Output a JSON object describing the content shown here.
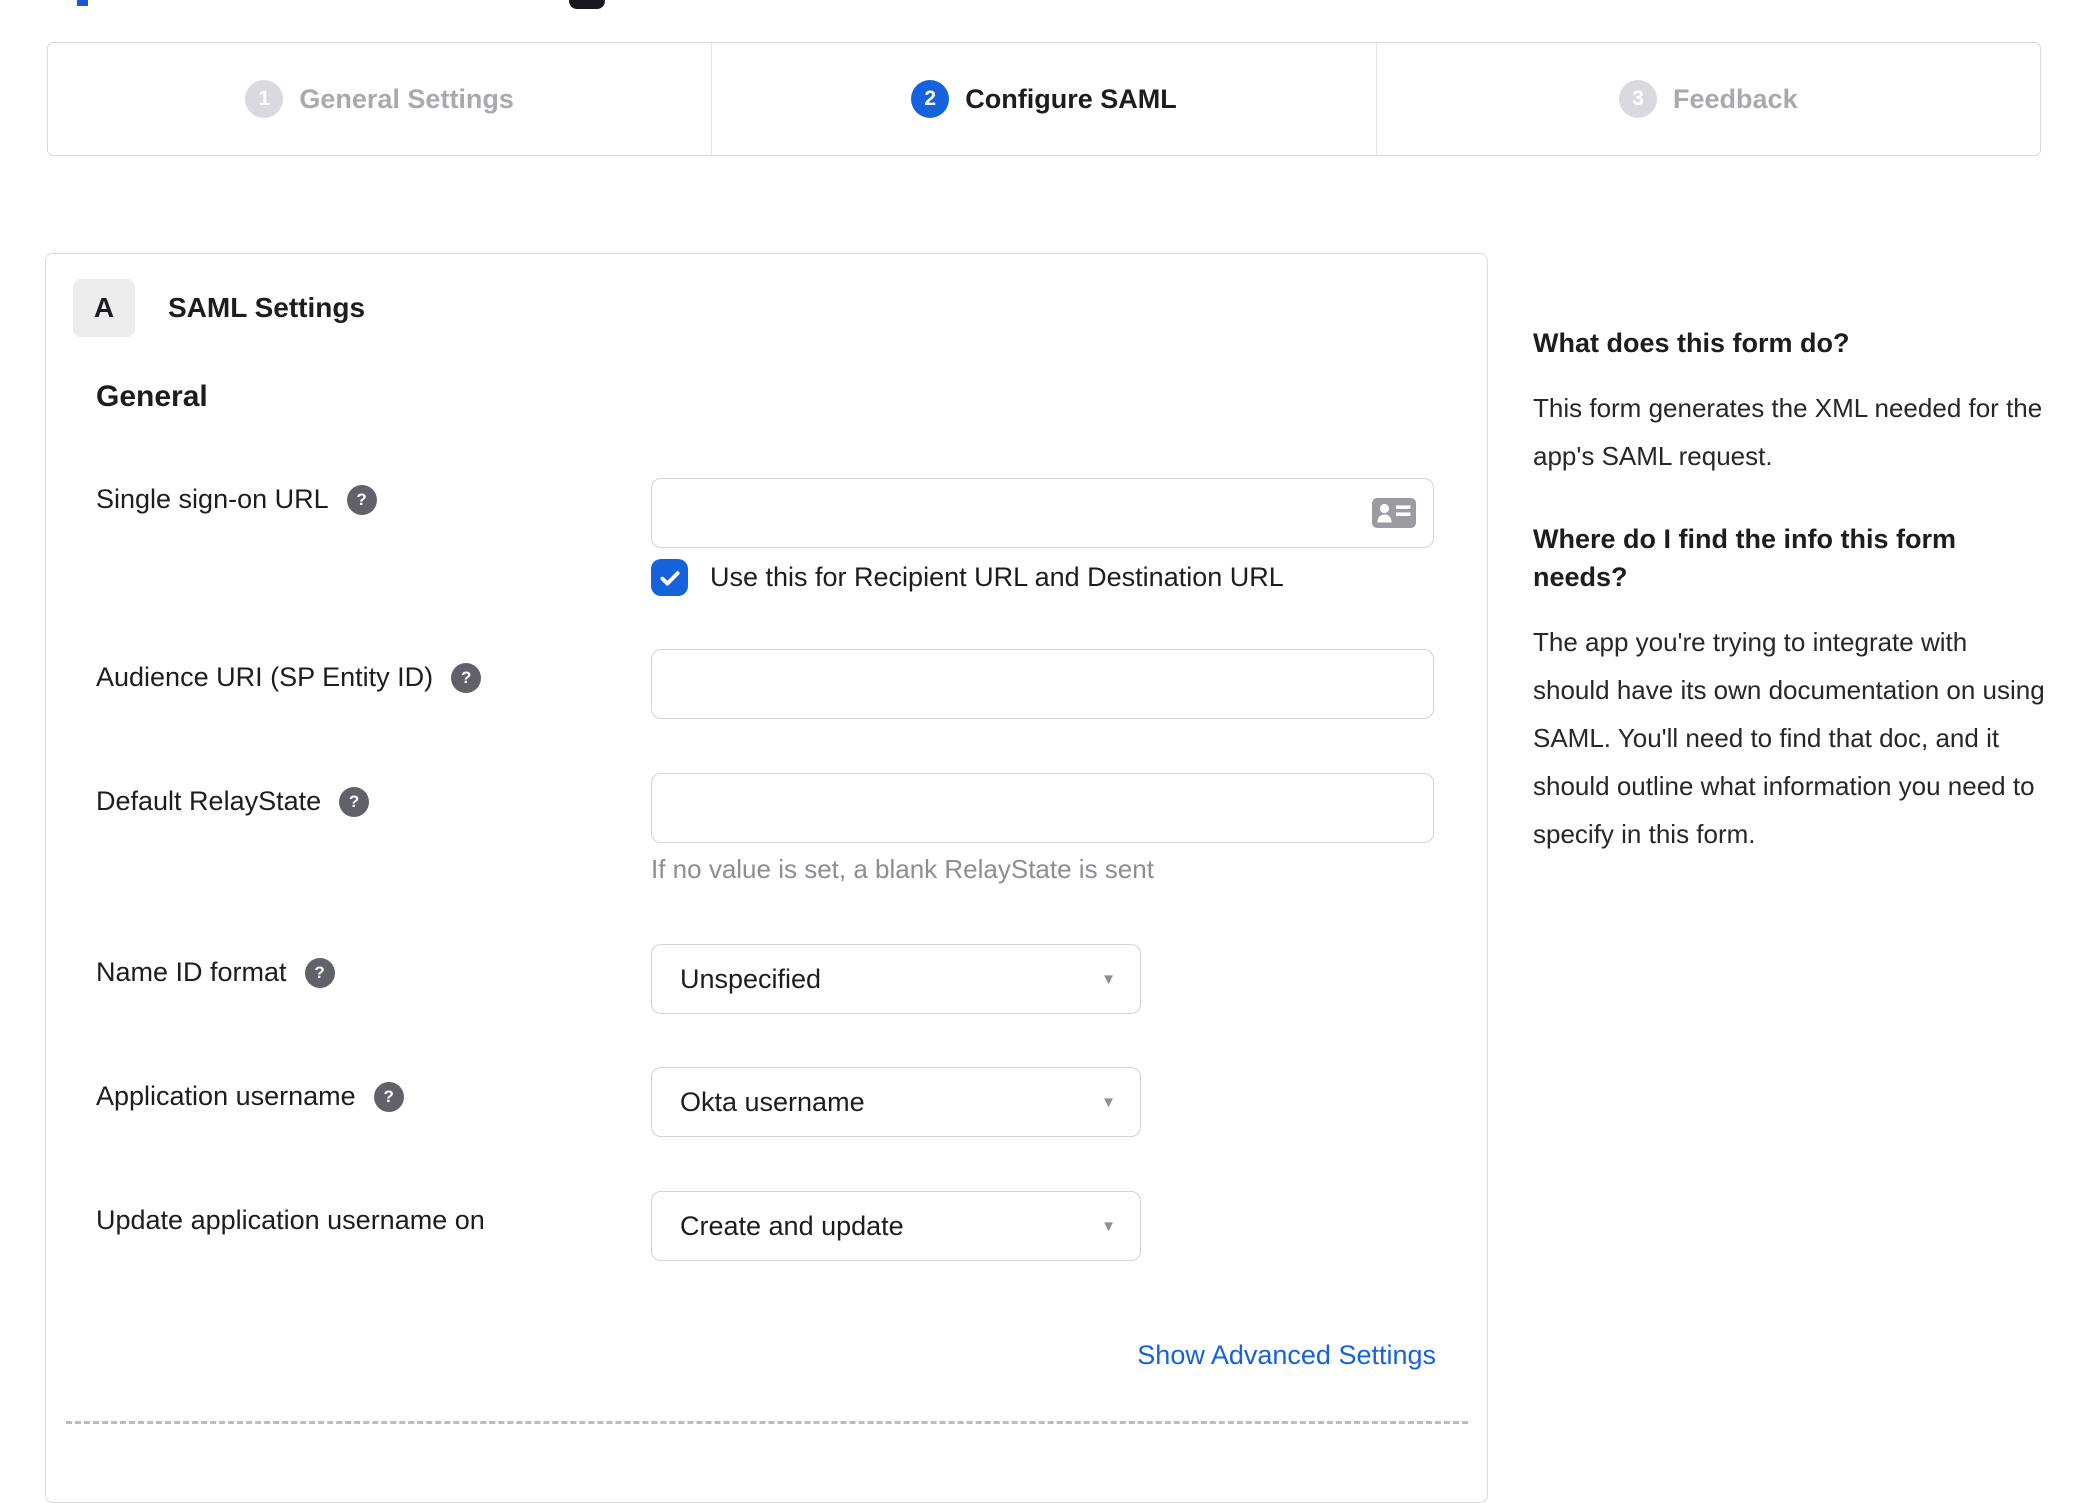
{
  "fragments": {
    "logo_fragment": "cropped-blue-logo-edge",
    "toggle_fragment": "cropped-black-control-edge"
  },
  "stepper": {
    "steps": [
      {
        "number": "1",
        "label": "General Settings",
        "state": "inactive"
      },
      {
        "number": "2",
        "label": "Configure SAML",
        "state": "active"
      },
      {
        "number": "3",
        "label": "Feedback",
        "state": "inactive"
      }
    ]
  },
  "panel": {
    "badge": "A",
    "title": "SAML Settings",
    "section_heading": "General",
    "sso": {
      "label": "Single sign-on URL",
      "value": "",
      "checkbox_label": "Use this for Recipient URL and Destination URL",
      "checkbox_checked": true
    },
    "audience": {
      "label": "Audience URI (SP Entity ID)",
      "value": ""
    },
    "relay": {
      "label": "Default RelayState",
      "value": "",
      "hint": "If no value is set, a blank RelayState is sent"
    },
    "name_id": {
      "label": "Name ID format",
      "value": "Unspecified"
    },
    "app_username": {
      "label": "Application username",
      "value": "Okta username"
    },
    "update_username": {
      "label": "Update application username on",
      "value": "Create and update"
    },
    "advanced_link": "Show Advanced Settings"
  },
  "sidebar": {
    "heading1": "What does this form do?",
    "body1": "This form generates the XML needed for the app's SAML request.",
    "heading2": "Where do I find the info this form needs?",
    "body2": "The app you're trying to integrate with should have its own documentation on using SAML. You'll need to find that doc, and it should outline what information you need to specify in this form."
  },
  "icons": {
    "help_glyph": "?",
    "caret_glyph": "▼"
  },
  "colors": {
    "accent_blue": "#1662dd",
    "link_blue": "#1662dd",
    "inactive_gray": "#d9d9de",
    "border_gray": "#d3d3d8",
    "text_dark": "#1d1d21",
    "muted_gray": "#8d8d95"
  }
}
